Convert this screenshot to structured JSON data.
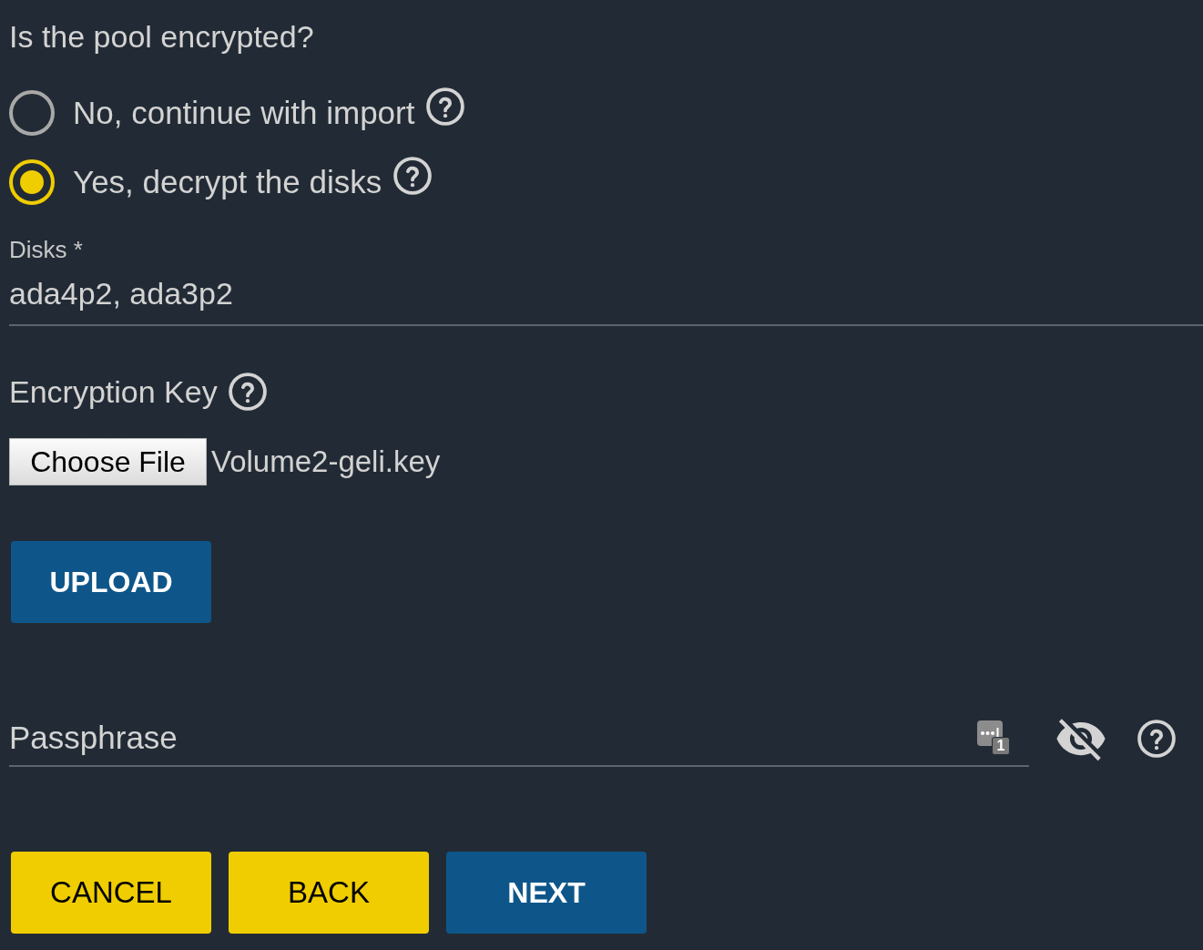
{
  "question": {
    "text": "Is the pool encrypted?"
  },
  "options": [
    {
      "label": "No, continue with import",
      "selected": false
    },
    {
      "label": "Yes, decrypt the disks",
      "selected": true
    }
  ],
  "disks": {
    "label": "Disks *",
    "value": "ada4p2, ada3p2"
  },
  "encryption_key": {
    "label": "Encryption Key",
    "choose_button": "Choose File",
    "file_name": "Volume2-geli.key"
  },
  "upload_button": {
    "label": "UPLOAD",
    "kind": "primary"
  },
  "passphrase": {
    "placeholder": "Passphrase",
    "autofill_count": "1"
  },
  "buttons": [
    {
      "label": "CANCEL",
      "kind": "secondary"
    },
    {
      "label": "BACK",
      "kind": "secondary"
    },
    {
      "label": "NEXT",
      "kind": "primary"
    }
  ]
}
